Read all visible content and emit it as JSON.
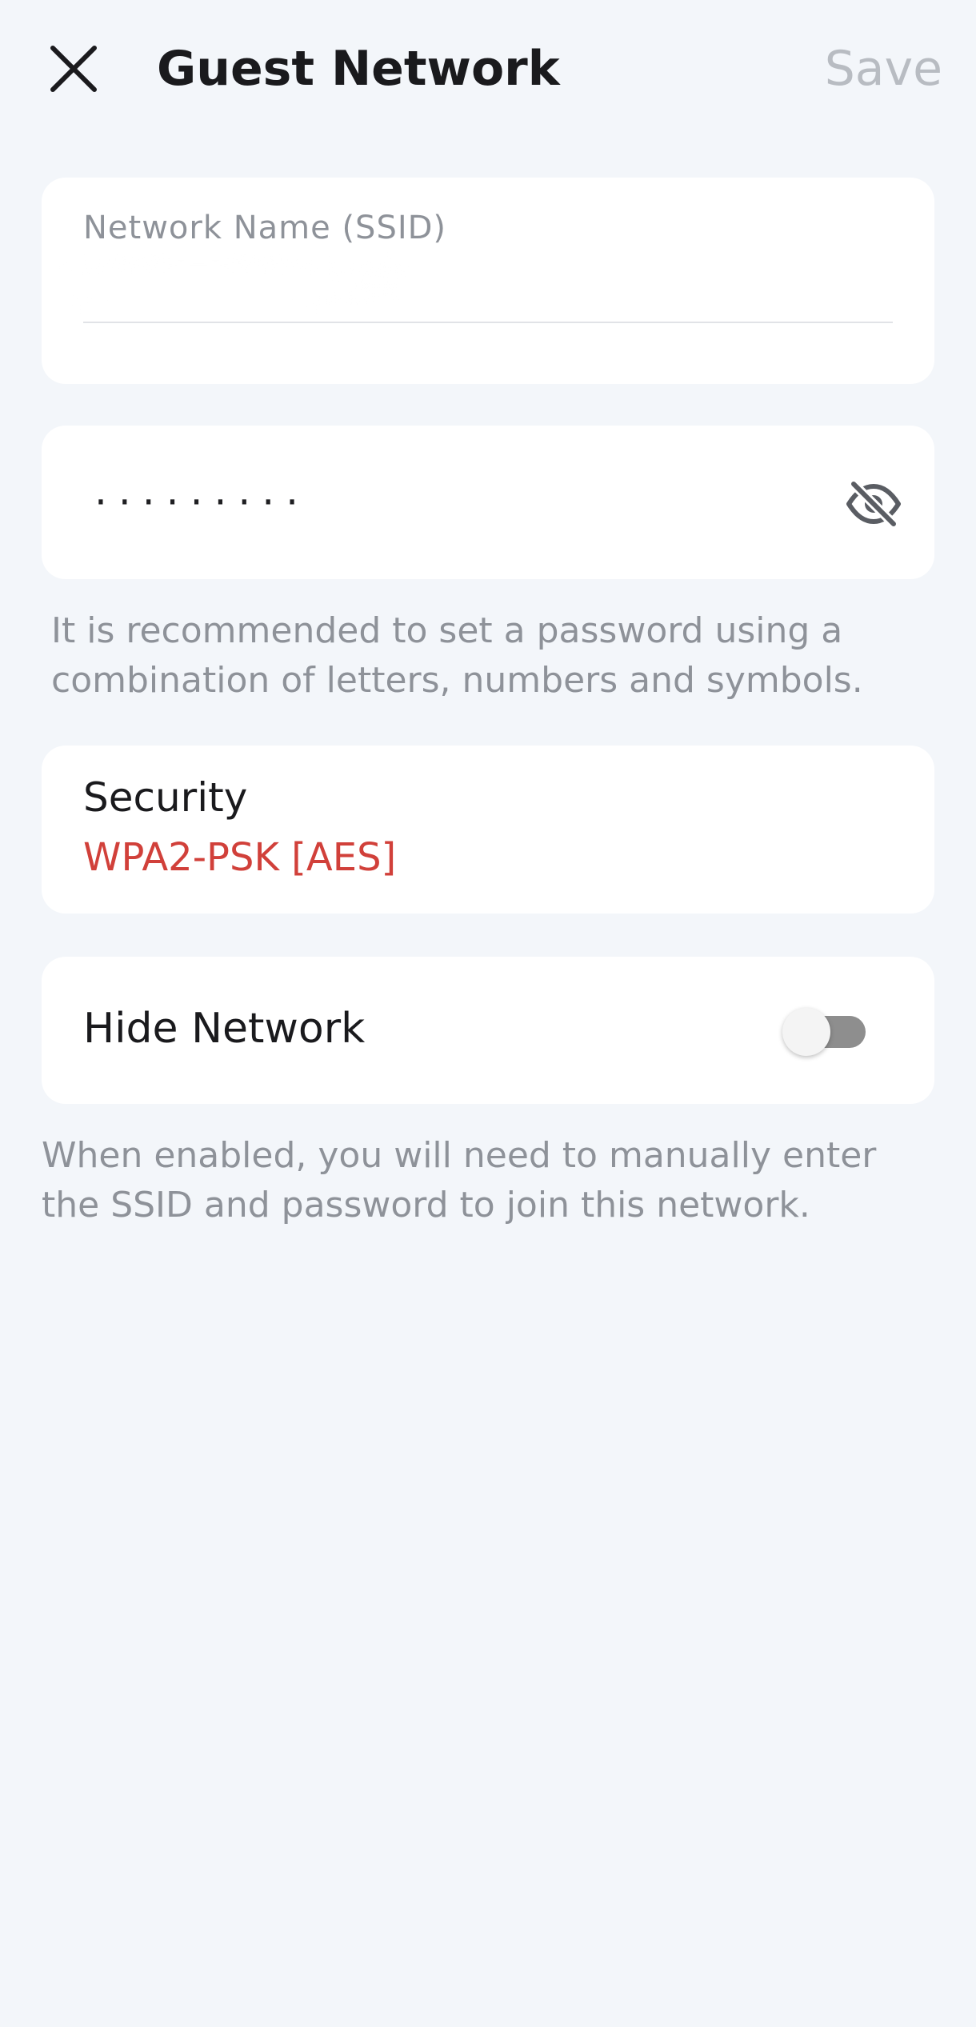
{
  "header": {
    "title": "Guest Network",
    "save_label": "Save",
    "close_icon": "close-icon"
  },
  "ssid": {
    "label": "Network Name (SSID)",
    "value": ""
  },
  "password": {
    "masked_value": "·········",
    "visibility_icon": "eye-off-icon",
    "hint": "It is recommended to set a password using a combination of letters, numbers and symbols."
  },
  "security": {
    "label": "Security",
    "value": "WPA2-PSK [AES]"
  },
  "hide_network": {
    "label": "Hide Network",
    "enabled": false,
    "hint": "When enabled, you will need to manually enter the SSID and password to join this network."
  },
  "colors": {
    "background": "#f3f6fa",
    "card": "#ffffff",
    "accent_red": "#d1403a",
    "muted_text": "#8e9299",
    "disabled_save": "#b8bcc2"
  }
}
